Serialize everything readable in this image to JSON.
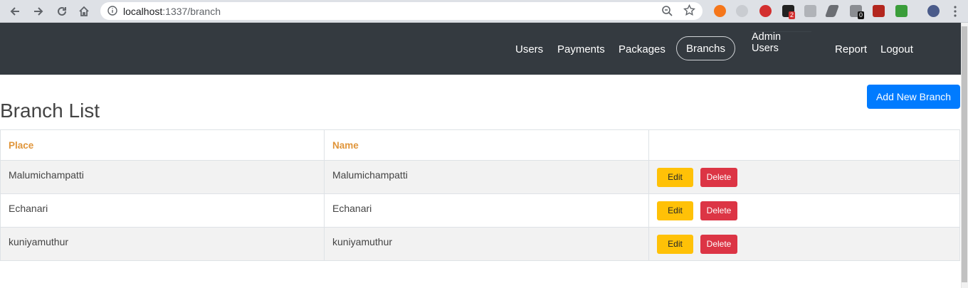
{
  "browser": {
    "url_host": "localhost",
    "url_path": ":1337/branch",
    "extension_badges": [
      "2",
      "0"
    ]
  },
  "navbar": {
    "items": [
      "Users",
      "Payments",
      "Packages",
      "Branchs",
      "Admin Users",
      "Report",
      "Logout"
    ],
    "active": "Branchs"
  },
  "page": {
    "title": "Branch List",
    "add_button": "Add New Branch"
  },
  "table": {
    "headers": [
      "Place",
      "Name",
      ""
    ],
    "rows": [
      {
        "place": "Malumichampatti",
        "name": "Malumichampatti"
      },
      {
        "place": "Echanari",
        "name": "Echanari"
      },
      {
        "place": "kuniyamuthur",
        "name": "kuniyamuthur"
      }
    ],
    "edit_label": "Edit",
    "edit_icon_glyph": "",
    "delete_label": "Delete"
  },
  "colors": {
    "navbar_bg": "#343a40",
    "primary": "#007bff",
    "warning": "#ffc107",
    "danger": "#dc3545",
    "header_text": "#e0953a"
  }
}
